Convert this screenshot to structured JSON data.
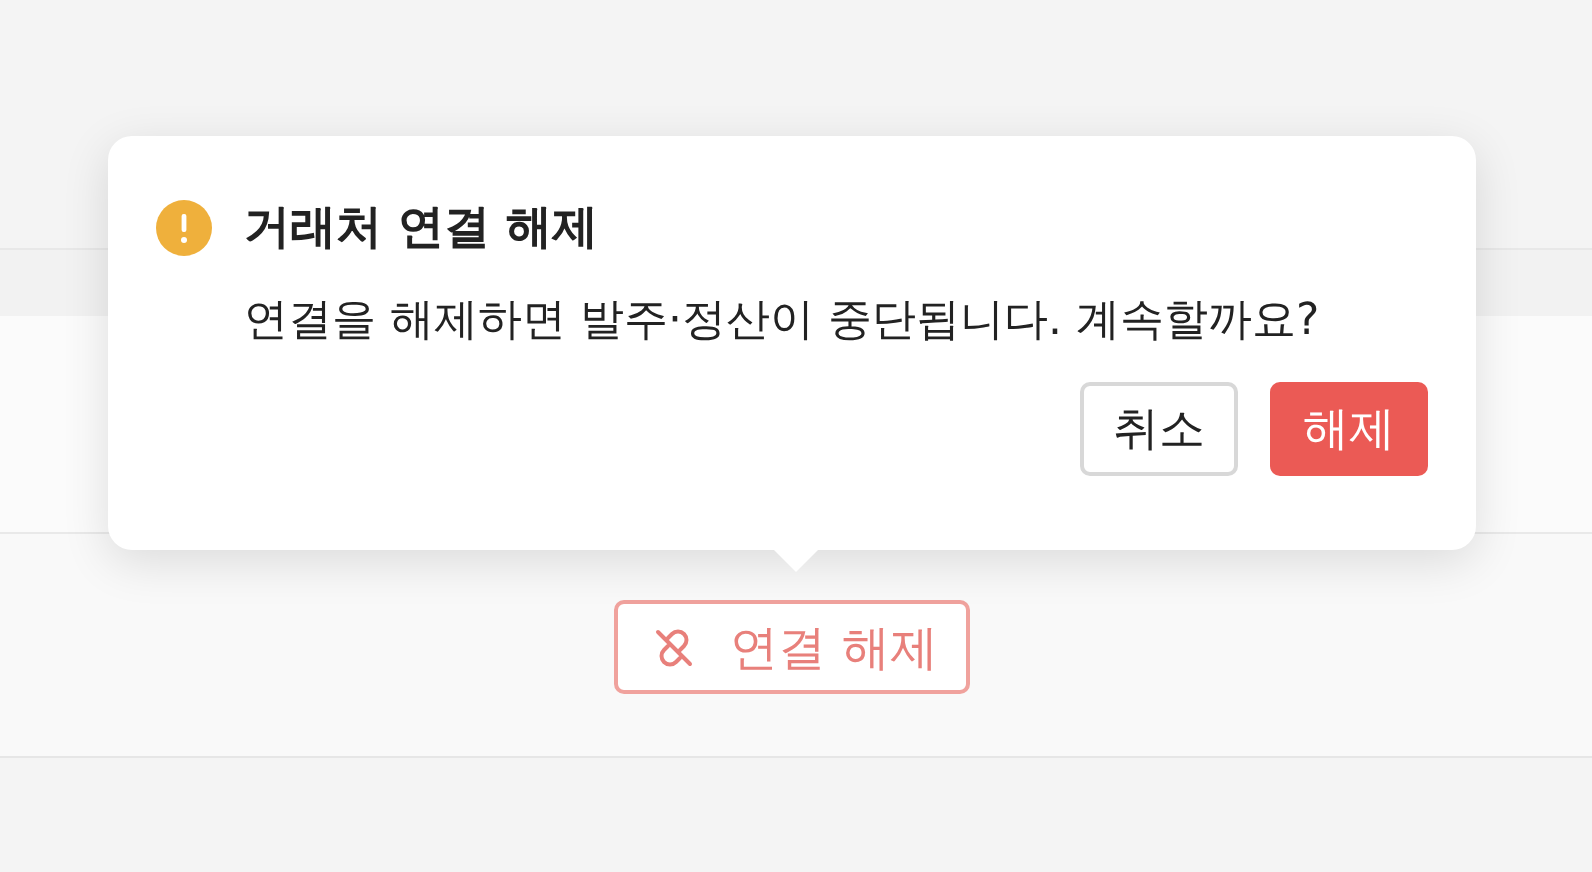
{
  "popover": {
    "title": "거래처 연결 해제",
    "message": "연결을 해제하면 발주·정산이 중단됩니다. 계속할까요?",
    "buttons": [
      {
        "label": "취소",
        "kind": "secondary"
      },
      {
        "label": "해제",
        "kind": "danger"
      }
    ]
  },
  "trigger": {
    "label": "연결 해제"
  }
}
